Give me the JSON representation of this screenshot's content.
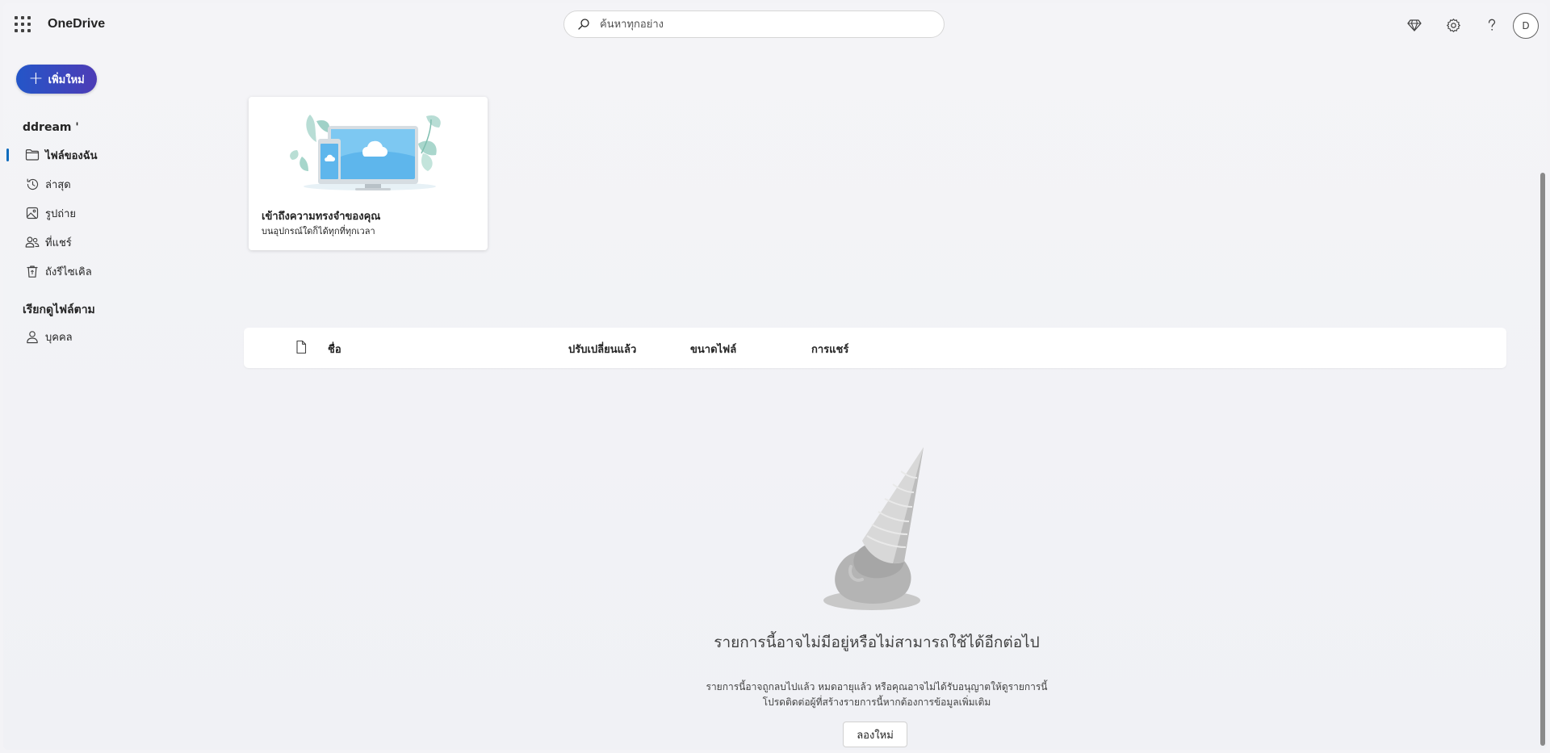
{
  "app": {
    "title": "OneDrive"
  },
  "search": {
    "placeholder": "ค้นหาทุกอย่าง"
  },
  "header": {
    "icons": [
      "premium-diamond-icon",
      "gear-icon",
      "help-icon"
    ],
    "avatar_initial": "D"
  },
  "sidebar": {
    "new_button": "เพิ่มใหม่",
    "account_name": "ddream '",
    "items": [
      {
        "label": "ไฟล์ของฉัน",
        "icon": "folder-icon",
        "active": true
      },
      {
        "label": "ล่าสุด",
        "icon": "history-icon",
        "active": false
      },
      {
        "label": "รูปถ่าย",
        "icon": "image-icon",
        "active": false
      },
      {
        "label": "ที่แชร์",
        "icon": "people-icon",
        "active": false
      },
      {
        "label": "ถังรีไซเคิล",
        "icon": "recycle-bin-icon",
        "active": false
      }
    ],
    "section_title": "เรียกดูไฟล์ตาม",
    "section_items": [
      {
        "label": "บุคคล",
        "icon": "person-icon"
      }
    ]
  },
  "promo": {
    "title": "เข้าถึงความทรงจำของคุณ",
    "subtitle": "บนอุปกรณ์ใดก็ได้ทุกที่ทุกเวลา"
  },
  "table": {
    "columns": {
      "name": "ชื่อ",
      "modified": "ปรับเปลี่ยนแล้ว",
      "size": "ขนาดไฟล์",
      "sharing": "การแชร์"
    }
  },
  "empty_state": {
    "title": "รายการนี้อาจไม่มีอยู่หรือไม่สามารถใช้ได้อีกต่อไป",
    "description": "รายการนี้อาจถูกลบไปแล้ว หมดอายุแล้ว หรือคุณอาจไม่ได้รับอนุญาตให้ดูรายการนี้ โปรดติดต่อผู้ที่สร้างรายการนี้หากต้องการข้อมูลเพิ่มเติม",
    "retry_button": "ลองใหม่"
  },
  "colors": {
    "accent": "#0f6cbd",
    "new_button_start": "#2456c8",
    "new_button_end": "#4d3cb6",
    "background": "#f3f3f6"
  }
}
